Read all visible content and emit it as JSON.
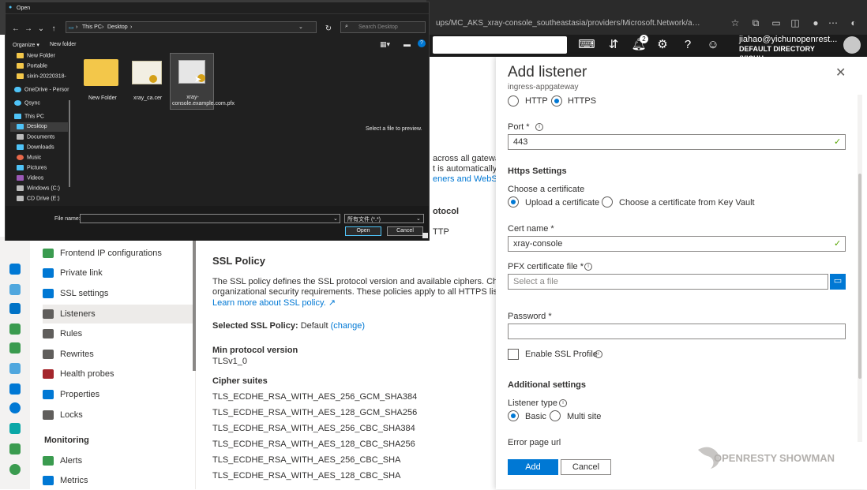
{
  "browser": {
    "address": "ups/MC_AKS_xray-console_southeastasia/providers/Microsoft.Network/applicationGateways/ingress-..."
  },
  "azure_header": {
    "notification_count": "2",
    "user_email": "jiahao@yichunopenrest...",
    "user_directory": "DEFAULT DIRECTORY (YICHU..."
  },
  "menu": {
    "items": [
      {
        "label": "Frontend IP configurations"
      },
      {
        "label": "Private link"
      },
      {
        "label": "SSL settings"
      },
      {
        "label": "Listeners"
      },
      {
        "label": "Rules"
      },
      {
        "label": "Rewrites"
      },
      {
        "label": "Health probes"
      },
      {
        "label": "Properties"
      },
      {
        "label": "Locks"
      }
    ],
    "section_monitoring": "Monitoring",
    "monitoring_items": [
      {
        "label": "Alerts"
      },
      {
        "label": "Metrics"
      }
    ]
  },
  "middle": {
    "frag1": "across all gatewa",
    "frag2": "t is automatically",
    "frag3": "eners and WebSoc",
    "frag4": "otocol",
    "frag5": "TTP",
    "ssl_policy_title": "SSL Policy",
    "ssl_desc1": "The SSL policy defines the SSL protocol version and available ciphers. Choose t",
    "ssl_desc2": "organizational security requirements. These policies apply to all HTTPS listener",
    "ssl_learn": "Learn more about SSL policy.",
    "selected_label": "Selected SSL Policy:",
    "selected_value": "Default",
    "selected_change": "(change)",
    "min_proto_label": "Min protocol version",
    "min_proto_value": "TLSv1_0",
    "cipher_title": "Cipher suites",
    "ciphers": [
      "TLS_ECDHE_RSA_WITH_AES_256_GCM_SHA384",
      "TLS_ECDHE_RSA_WITH_AES_128_GCM_SHA256",
      "TLS_ECDHE_RSA_WITH_AES_256_CBC_SHA384",
      "TLS_ECDHE_RSA_WITH_AES_128_CBC_SHA256",
      "TLS_ECDHE_RSA_WITH_AES_256_CBC_SHA",
      "TLS_ECDHE_RSA_WITH_AES_128_CBC_SHA"
    ]
  },
  "panel": {
    "title": "Add listener",
    "subtitle": "ingress-appgateway",
    "proto_http": "HTTP",
    "proto_https": "HTTPS",
    "port_label": "Port *",
    "port_value": "443",
    "https_settings": "Https Settings",
    "choose_cert": "Choose a certificate",
    "upload_cert": "Upload a certificate",
    "keyvault_cert": "Choose a certificate from Key Vault",
    "cert_name_label": "Cert name *",
    "cert_name_value": "xray-console",
    "pfx_label": "PFX certificate file *",
    "pfx_placeholder": "Select a file",
    "password_label": "Password *",
    "enable_ssl_profile": "Enable SSL Profile",
    "additional_settings": "Additional settings",
    "listener_type_label": "Listener type",
    "listener_basic": "Basic",
    "listener_multi": "Multi site",
    "error_page_label": "Error page url",
    "add_button": "Add",
    "cancel_button": "Cancel"
  },
  "watermark": {
    "brand_a": "OPENRESTY",
    "brand_b": "SHOWMAN"
  },
  "dialog": {
    "title": "Open",
    "path_a": "This PC",
    "path_b": "Desktop",
    "search_placeholder": "Search Desktop",
    "organize": "Organize",
    "new_folder": "New folder",
    "tree": [
      "New Folder",
      "Portable",
      "sixin-20220318-",
      "OneDrive - Persor",
      "Qsync",
      "This PC",
      "Desktop",
      "Documents",
      "Downloads",
      "Music",
      "Pictures",
      "Videos",
      "Windows (C:)",
      "CD Drive (E:)"
    ],
    "files": [
      {
        "name": "New Folder"
      },
      {
        "name": "xray_ca.cer"
      },
      {
        "name": "xray-console.example.com.pfx"
      }
    ],
    "preview_text": "Select a file to preview.",
    "filename_label": "File name:",
    "filetype_value": "所有文件 (*.*)",
    "open_button": "Open",
    "cancel_button": "Cancel"
  }
}
